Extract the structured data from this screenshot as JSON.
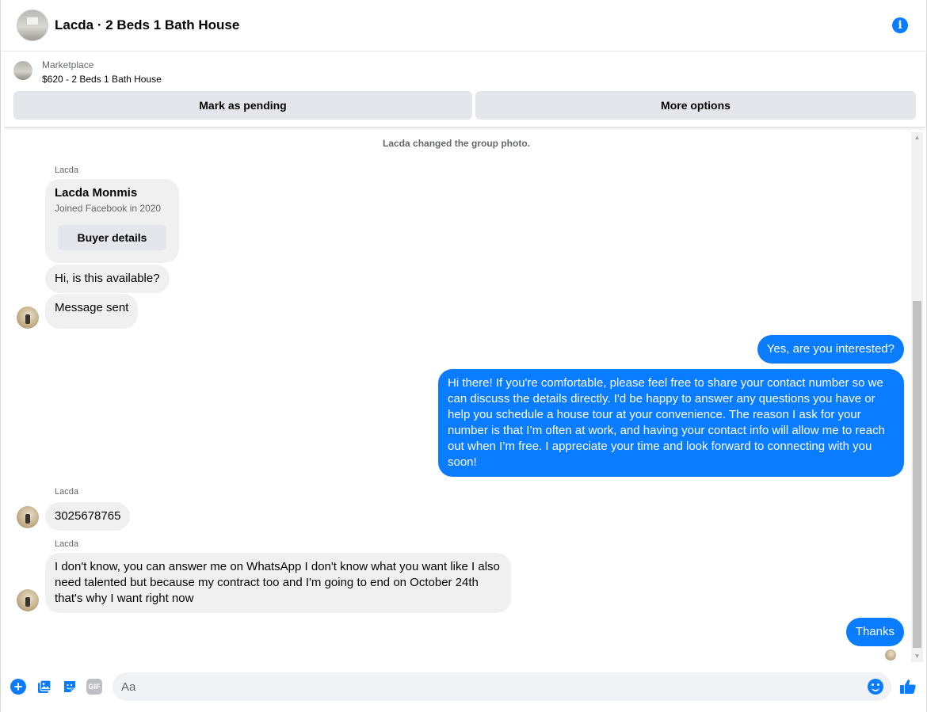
{
  "header": {
    "title": "Lacda · 2 Beds 1 Bath House",
    "info_icon": "info-icon"
  },
  "marketplace": {
    "label": "Marketplace",
    "listing": "$620 - 2 Beds 1 Bath House",
    "mark_pending_label": "Mark as pending",
    "more_options_label": "More options"
  },
  "chat": {
    "system_message": "Lacda changed the group photo.",
    "buyer_card": {
      "sender": "Lacda",
      "name": "Lacda Monmis",
      "joined": "Joined Facebook in 2020",
      "button_label": "Buyer details"
    },
    "messages": [
      {
        "direction": "in",
        "sender": "",
        "text": "Hi, is this available?"
      },
      {
        "direction": "in",
        "sender": "",
        "text": "Message sent"
      },
      {
        "direction": "out",
        "text": "Yes, are you interested?"
      },
      {
        "direction": "out",
        "text": "Hi there! If you're comfortable, please feel free to share your contact number so we can discuss the details directly. I'd be happy to answer any questions you have or help you schedule a house tour at your convenience. The reason I ask for your number is that I’m often at work, and having your contact info will allow me to reach out when I’m free. I appreciate your time and look forward to connecting with you soon!"
      },
      {
        "direction": "in",
        "sender": "Lacda",
        "text": "3025678765"
      },
      {
        "direction": "in",
        "sender": "Lacda",
        "text": "I don't know, you can answer me on WhatsApp I don't know what you want like I also need talented but because my contract too and I'm going to end on October 24th that's why I want right now"
      },
      {
        "direction": "out",
        "text": "Thanks"
      }
    ]
  },
  "composer": {
    "placeholder": "Aa",
    "gif_label": "GIF",
    "icons": [
      "plus-icon",
      "photo-icon",
      "sticker-icon",
      "gif-icon",
      "emoji-icon",
      "thumbs-up-icon"
    ]
  },
  "colors": {
    "accent": "#0a7cff",
    "incoming_bubble": "#f0f0f0",
    "button_bg": "#e4e6eb",
    "secondary_text": "#65676b"
  }
}
